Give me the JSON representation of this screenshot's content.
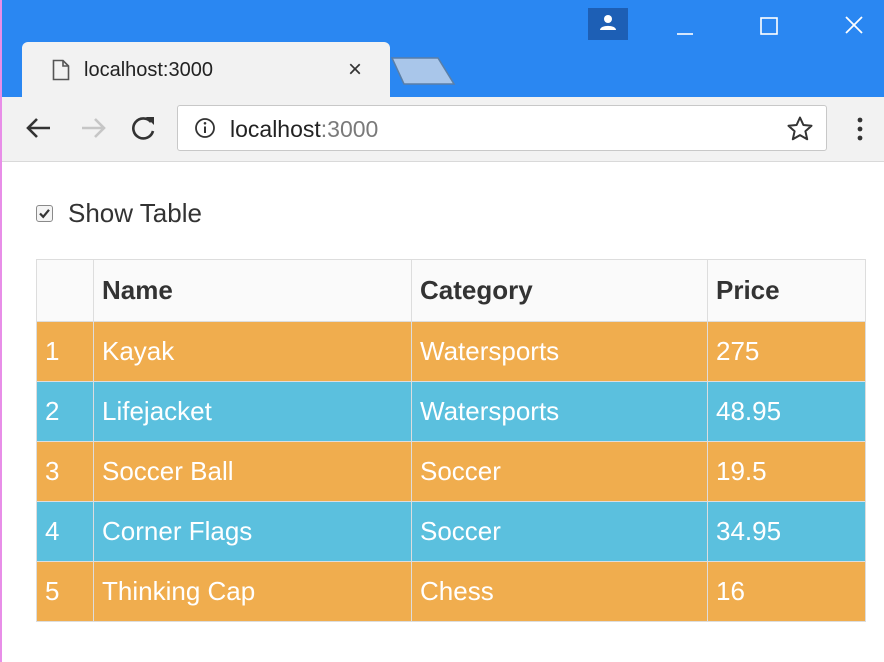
{
  "browser": {
    "tab": {
      "title": "localhost:3000",
      "close_glyph": "×",
      "icon": "page-icon"
    },
    "new_tab_icon": "new-tab-icon",
    "window_controls": [
      "profile-icon",
      "minimize-icon",
      "maximize-icon",
      "close-icon"
    ],
    "colors": {
      "titlebar": "#2a87f2",
      "toolbar": "#f2f2f2"
    }
  },
  "toolbar": {
    "back_icon": "back-arrow-icon",
    "forward_icon": "forward-arrow-icon",
    "reload_icon": "reload-icon",
    "address": {
      "host": "localhost",
      "port": ":3000",
      "info_icon": "info-icon"
    },
    "bookmark_icon": "star-icon",
    "menu_icon": "kebab-menu-icon"
  },
  "page": {
    "show_table": {
      "label": "Show Table",
      "checked": true
    },
    "table": {
      "columns": [
        "",
        "Name",
        "Category",
        "Price"
      ],
      "rows": [
        {
          "index": "1",
          "name": "Kayak",
          "category": "Watersports",
          "price": "275",
          "style": "warning"
        },
        {
          "index": "2",
          "name": "Lifejacket",
          "category": "Watersports",
          "price": "48.95",
          "style": "info"
        },
        {
          "index": "3",
          "name": "Soccer Ball",
          "category": "Soccer",
          "price": "19.5",
          "style": "warning"
        },
        {
          "index": "4",
          "name": "Corner Flags",
          "category": "Soccer",
          "price": "34.95",
          "style": "info"
        },
        {
          "index": "5",
          "name": "Thinking Cap",
          "category": "Chess",
          "price": "16",
          "style": "warning"
        }
      ],
      "colors": {
        "warning": "#f0ad4e",
        "info": "#5bc0de"
      }
    }
  }
}
